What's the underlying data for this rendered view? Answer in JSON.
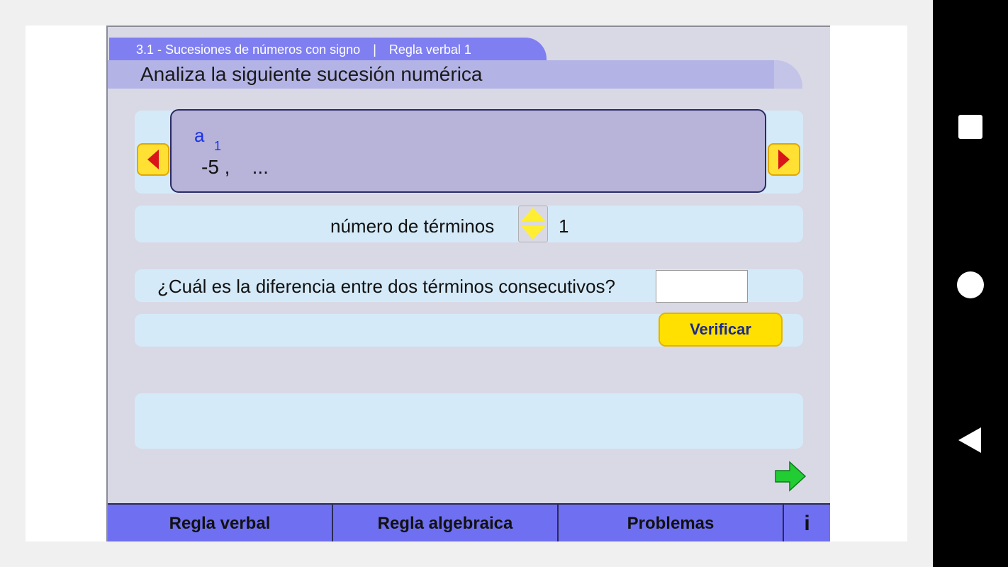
{
  "header": {
    "section": "3.1  -  Sucesiones de números con signo",
    "separator": "|",
    "subsection": "Regla verbal 1",
    "title": "Analiza la siguiente sucesión numérica"
  },
  "sequence": {
    "term_label": "a",
    "term_index": "1",
    "values_text": "-5 ,    ..."
  },
  "terms": {
    "label": "número de términos",
    "count": "1"
  },
  "question": {
    "text": "¿Cuál es la diferencia entre dos términos consecutivos?",
    "answer_value": ""
  },
  "actions": {
    "verify_label": "Verificar"
  },
  "tabs": [
    {
      "label": "Regla verbal"
    },
    {
      "label": "Regla algebraica"
    },
    {
      "label": "Problemas"
    },
    {
      "label": "i"
    }
  ],
  "colors": {
    "accent": "#7f7ff2",
    "button_yellow": "#ffe000",
    "arrow_red": "#d9141a",
    "next_green": "#22cc33"
  },
  "icons": {
    "prev": "triangle-left-icon",
    "next": "triangle-right-icon",
    "step_up": "triangle-up-icon",
    "step_down": "triangle-down-icon",
    "forward": "green-arrow-right-icon",
    "info": "info-icon"
  }
}
